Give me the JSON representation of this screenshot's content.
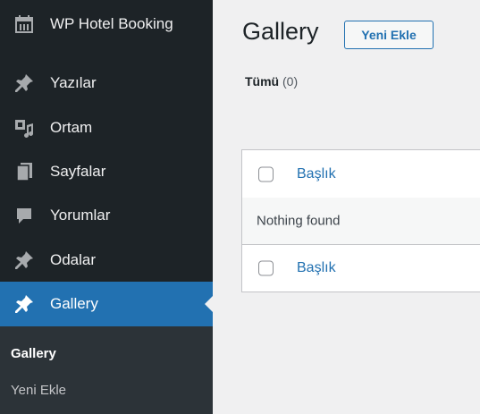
{
  "sidebar": {
    "items": [
      {
        "label": "WP Hotel Booking",
        "icon": "calendar-icon"
      },
      {
        "label": "Yazılar",
        "icon": "pin-icon"
      },
      {
        "label": "Ortam",
        "icon": "media-icon"
      },
      {
        "label": "Sayfalar",
        "icon": "pages-icon"
      },
      {
        "label": "Yorumlar",
        "icon": "comment-icon"
      },
      {
        "label": "Odalar",
        "icon": "pin-icon"
      },
      {
        "label": "Gallery",
        "icon": "pin-icon",
        "active": true
      }
    ],
    "submenu": [
      {
        "label": "Gallery",
        "current": true
      },
      {
        "label": "Yeni Ekle"
      }
    ]
  },
  "main": {
    "title": "Gallery",
    "add_new_label": "Yeni Ekle",
    "filters": {
      "all_label": "Tümü",
      "all_count": "(0)"
    },
    "table": {
      "column_title": "Başlık",
      "empty_message": "Nothing found"
    }
  },
  "colors": {
    "sidebar_bg": "#1d2327",
    "submenu_bg": "#2c3338",
    "accent": "#2271b1",
    "page_bg": "#f0f0f1"
  }
}
